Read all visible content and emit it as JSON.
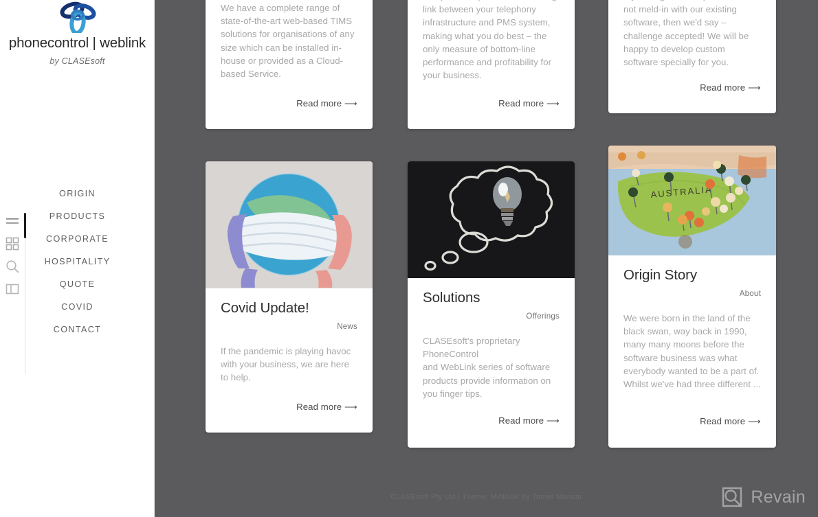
{
  "sidebar": {
    "brand": {
      "logo_icon": "trefoil-swirl-logo",
      "title": "phonecontrol | weblink",
      "subtitle": "by CLASEsoft",
      "logo_color_dark": "#1b3a7a",
      "logo_color_light": "#3aa6d8"
    },
    "rail_icons": [
      {
        "name": "hamburger-menu-icon",
        "label": "Menu"
      },
      {
        "name": "grid-view-icon",
        "label": "Grid"
      },
      {
        "name": "search-icon",
        "label": "Search"
      },
      {
        "name": "columns-layout-icon",
        "label": "Columns"
      }
    ],
    "nav_items": [
      {
        "label": "ORIGIN"
      },
      {
        "label": "PRODUCTS"
      },
      {
        "label": "CORPORATE"
      },
      {
        "label": "HOSPITALITY"
      },
      {
        "label": "QUOTE"
      },
      {
        "label": "COVID"
      },
      {
        "label": "CONTACT"
      }
    ]
  },
  "main": {
    "cards": [
      {
        "id": "tims-solutions",
        "title": "",
        "category": "",
        "text": "We have a complete range of state-of-the-art web-based TIMS solutions for organisations of any size which can be installed in-house or provided as a Cloud-based Service.",
        "read_more": "Read more ⟶",
        "image": ""
      },
      {
        "id": "missing-link",
        "title": "",
        "category": "",
        "text": "Our products provide the missing link between your telephony infrastructure and PMS system, making what you do best – the only measure of bottom-line performance and profitability for your business.",
        "read_more": "Read more ⟶",
        "image": ""
      },
      {
        "id": "custom-software",
        "title": "",
        "category": "",
        "text": "If you've got a set-up that does not meld-in with our existing software, then we'd say – challenge accepted! We will be happy to develop custom software specially for you.",
        "read_more": "Read more ⟶",
        "image": ""
      },
      {
        "id": "covid-update",
        "title": "Covid Update!",
        "category": "News",
        "text": "If the pandemic is playing havoc with your business, we are here to help.",
        "read_more": "Read more ⟶",
        "image": "globe-with-face-mask-photo"
      },
      {
        "id": "solutions",
        "title": "Solutions",
        "category": "Offerings",
        "text": "CLASEsoft's proprietary PhoneControl\nand WebLink series of software products provide information on you finger tips.",
        "read_more": "Read more ⟶",
        "image": "chalkboard-lightbulb-thought-bubble-photo"
      },
      {
        "id": "origin-story",
        "title": "Origin Story",
        "category": "About",
        "text": "We were born in the land of the black swan, way back in 1990, many many moons before the software business was what everybody wanted to be a part of. Whilst we've had three different ...",
        "read_more": "Read more ⟶",
        "image": "australia-map-with-pins-photo"
      }
    ]
  },
  "footer": {
    "text": "CLASEsoft Pty Ltd | Theme: MiNNaK by Tamer Mancar"
  },
  "watermark": {
    "text": "Revain",
    "icon": "revain-logo-icon"
  },
  "colors": {
    "page_background": "#5b5b5d",
    "card_background": "#ffffff",
    "body_text": "#a8a8a8",
    "heading_text": "#2e2e2e",
    "nav_text": "#5f5f5f"
  }
}
